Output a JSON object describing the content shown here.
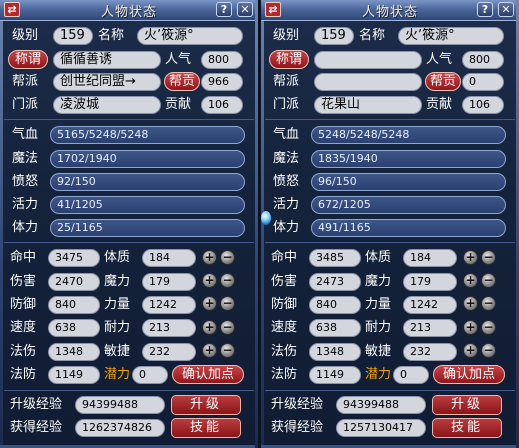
{
  "panels": [
    {
      "title": "人物状态",
      "menu_icon": "⇄",
      "help_label": "?",
      "close_label": "✕",
      "level": {
        "label": "级别",
        "value": "159"
      },
      "name": {
        "label": "名称",
        "value": "火’筱源°"
      },
      "titlebtn": {
        "label": "称谓",
        "value": "循循善诱"
      },
      "popularity": {
        "label": "人气",
        "value": "800"
      },
      "gang": {
        "label": "帮派",
        "value": "创世纪同盟→"
      },
      "gang_contribution": {
        "label": "帮贡",
        "value": "966"
      },
      "sect": {
        "label": "门派",
        "value": "凌波城"
      },
      "contribution": {
        "label": "贡献",
        "value": "106"
      },
      "qixue": {
        "label": "气血",
        "value": "5165/5248/5248"
      },
      "mofa": {
        "label": "魔法",
        "value": "1702/1940"
      },
      "fennu": {
        "label": "愤怒",
        "value": "92/150"
      },
      "huoli": {
        "label": "活力",
        "value": "41/1205"
      },
      "tili": {
        "label": "体力",
        "value": "25/1165"
      },
      "stats_left": [
        {
          "label": "命中",
          "value": "3475"
        },
        {
          "label": "伤害",
          "value": "2470"
        },
        {
          "label": "防御",
          "value": "840"
        },
        {
          "label": "速度",
          "value": "638"
        },
        {
          "label": "法伤",
          "value": "1348"
        },
        {
          "label": "法防",
          "value": "1149"
        }
      ],
      "stats_right": [
        {
          "label": "体质",
          "value": "184"
        },
        {
          "label": "魔力",
          "value": "179"
        },
        {
          "label": "力量",
          "value": "1242"
        },
        {
          "label": "耐力",
          "value": "213"
        },
        {
          "label": "敏捷",
          "value": "232"
        }
      ],
      "potential": {
        "label": "潜力",
        "value": "0"
      },
      "confirm_label": "确认加点",
      "upgrade_exp": {
        "label": "升级经验",
        "value": "94399488"
      },
      "gained_exp": {
        "label": "获得经验",
        "value": "1262374826"
      },
      "upgrade_btn": "升级",
      "skills_btn": "技能",
      "plus": "+",
      "minus": "−"
    },
    {
      "title": "人物状态",
      "menu_icon": "⇄",
      "help_label": "?",
      "close_label": "✕",
      "level": {
        "label": "级别",
        "value": "159"
      },
      "name": {
        "label": "名称",
        "value": "火’筱源°"
      },
      "titlebtn": {
        "label": "称谓",
        "value": ""
      },
      "popularity": {
        "label": "人气",
        "value": "800"
      },
      "gang": {
        "label": "帮派",
        "value": ""
      },
      "gang_contribution": {
        "label": "帮贡",
        "value": "0"
      },
      "sect": {
        "label": "门派",
        "value": "花果山"
      },
      "contribution": {
        "label": "贡献",
        "value": "106"
      },
      "qixue": {
        "label": "气血",
        "value": "5248/5248/5248"
      },
      "mofa": {
        "label": "魔法",
        "value": "1835/1940"
      },
      "fennu": {
        "label": "愤怒",
        "value": "96/150"
      },
      "huoli": {
        "label": "活力",
        "value": "672/1205"
      },
      "tili": {
        "label": "体力",
        "value": "491/1165"
      },
      "stats_left": [
        {
          "label": "命中",
          "value": "3485"
        },
        {
          "label": "伤害",
          "value": "2473"
        },
        {
          "label": "防御",
          "value": "840"
        },
        {
          "label": "速度",
          "value": "638"
        },
        {
          "label": "法伤",
          "value": "1348"
        },
        {
          "label": "法防",
          "value": "1149"
        }
      ],
      "stats_right": [
        {
          "label": "体质",
          "value": "184"
        },
        {
          "label": "魔力",
          "value": "179"
        },
        {
          "label": "力量",
          "value": "1242"
        },
        {
          "label": "耐力",
          "value": "213"
        },
        {
          "label": "敏捷",
          "value": "232"
        }
      ],
      "potential": {
        "label": "潜力",
        "value": "0"
      },
      "confirm_label": "确认加点",
      "upgrade_exp": {
        "label": "升级经验",
        "value": "94399488"
      },
      "gained_exp": {
        "label": "获得经验",
        "value": "1257130417"
      },
      "upgrade_btn": "升级",
      "skills_btn": "技能",
      "plus": "+",
      "minus": "−"
    }
  ]
}
